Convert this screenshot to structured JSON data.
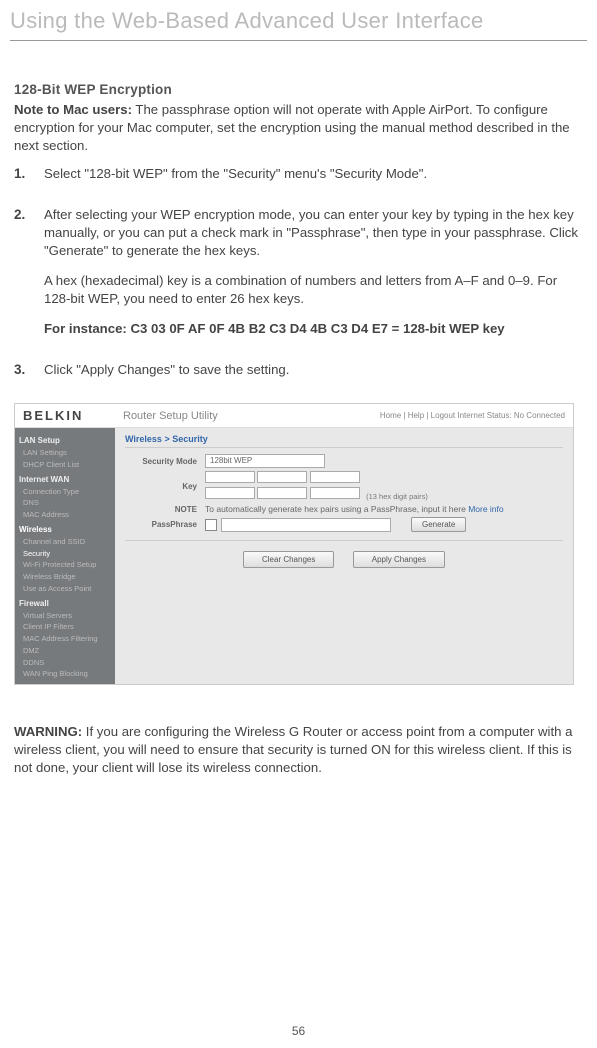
{
  "header": "Using the Web-Based Advanced User Interface",
  "sectionTitle": "128-Bit WEP Encryption",
  "noteLead": "Note to Mac users:",
  "noteBody": " The passphrase option will not operate with Apple AirPort. To configure encryption for your Mac computer, set the encryption using the manual method described in the next section.",
  "steps": [
    {
      "num": "1.",
      "paras": [
        "Select \"128-bit WEP\" from the \"Security\" menu's \"Security Mode\"."
      ]
    },
    {
      "num": "2.",
      "paras": [
        "After selecting your WEP encryption mode, you can enter your key by typing in the hex key manually, or you can put a check mark in \"Passphrase\", then type in your passphrase. Click \"Generate\" to generate the hex keys.",
        "A hex (hexadecimal) key is a combination of numbers and letters from A–F and 0–9. For 128-bit WEP, you need to enter 26 hex keys.",
        "For instance:  C3 03 0F AF 0F 4B B2 C3 D4 4B C3 D4 E7 = 128-bit WEP key"
      ],
      "boldIndexes": [
        2
      ]
    },
    {
      "num": "3.",
      "paras": [
        "Click \"Apply Changes\" to save the setting."
      ]
    }
  ],
  "screenshot": {
    "logo": "BELKIN",
    "utilityTitle": "Router Setup Utility",
    "topLinks": "Home | Help | Logout   Internet Status: No Connected",
    "sidebar": {
      "groups": [
        {
          "title": "LAN Setup",
          "items": [
            "LAN Settings",
            "DHCP Client List"
          ]
        },
        {
          "title": "Internet WAN",
          "items": [
            "Connection Type",
            "DNS",
            "MAC Address"
          ]
        },
        {
          "title": "Wireless",
          "items": [
            "Channel and SSID",
            "Security",
            "Wi-Fi Protected Setup",
            "Wireless Bridge",
            "Use as Access Point"
          ]
        },
        {
          "title": "Firewall",
          "items": [
            "Virtual Servers",
            "Client IP Filters",
            "MAC Address Filtering",
            "DMZ",
            "DDNS",
            "WAN Ping Blocking"
          ]
        }
      ]
    },
    "breadcrumb": "Wireless > Security",
    "labels": {
      "securityMode": "Security Mode",
      "key": "Key",
      "note": "NOTE",
      "passphrase": "PassPhrase"
    },
    "securityModeValue": "128bit WEP",
    "keyHint": "(13 hex digit pairs)",
    "noteText": "To automatically generate hex pairs using a PassPhrase, input it here ",
    "moreInfo": "More info",
    "buttons": {
      "generate": "Generate",
      "clear": "Clear Changes",
      "apply": "Apply Changes"
    }
  },
  "warningLead": "WARNING:",
  "warningBody": " If you are configuring the Wireless G Router or access point from a computer with a wireless client, you will need to ensure that security is turned ON for this wireless client. If this is not done, your client will lose its wireless connection.",
  "pageNumber": "56"
}
